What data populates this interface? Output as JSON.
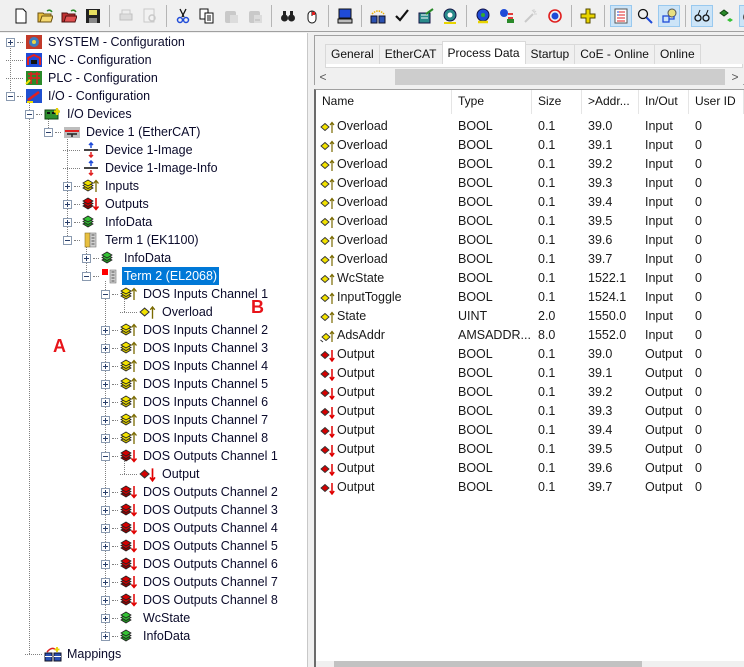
{
  "toolbar": {
    "buttons": [
      {
        "name": "new-icon"
      },
      {
        "name": "open-icon"
      },
      {
        "name": "open-project-icon"
      },
      {
        "name": "save-icon"
      },
      {
        "sep": true
      },
      {
        "name": "print-icon",
        "disabled": true
      },
      {
        "name": "print-preview-icon",
        "disabled": true
      },
      {
        "sep": true
      },
      {
        "name": "cut-icon"
      },
      {
        "name": "copy-icon"
      },
      {
        "name": "paste-icon",
        "disabled": true
      },
      {
        "name": "paste-with-links-icon",
        "disabled": true
      },
      {
        "sep": true
      },
      {
        "name": "find-icon"
      },
      {
        "name": "mouse-icon"
      },
      {
        "sep": true
      },
      {
        "name": "choose-target-icon"
      },
      {
        "sep": true
      },
      {
        "name": "generate-mappings-icon"
      },
      {
        "name": "check-configuration-icon"
      },
      {
        "name": "activate-configuration-icon"
      },
      {
        "name": "restart-config-mode-icon"
      },
      {
        "sep": true
      },
      {
        "name": "load-io-devices-icon"
      },
      {
        "name": "scan-devices-icon"
      },
      {
        "name": "wizard-icon",
        "disabled": true
      },
      {
        "name": "reload-icon"
      },
      {
        "sep": true
      },
      {
        "name": "add-item-icon"
      },
      {
        "sep": true
      },
      {
        "name": "show-list-icon",
        "active": true
      },
      {
        "name": "zoom-icon"
      },
      {
        "name": "online-values-icon",
        "active": true
      },
      {
        "sep": true
      },
      {
        "name": "watch-icon",
        "active": true
      },
      {
        "name": "toggle-icon"
      },
      {
        "name": "help-iq-icon",
        "active": true
      },
      {
        "sep": true
      },
      {
        "name": "help-book-icon"
      }
    ]
  },
  "tree": {
    "items": [
      {
        "label": "SYSTEM - Configuration",
        "level": 0,
        "expander": "plus",
        "icon": "system-config-icon"
      },
      {
        "label": "NC - Configuration",
        "level": 0,
        "expander": "none",
        "icon": "nc-config-icon"
      },
      {
        "label": "PLC - Configuration",
        "level": 0,
        "expander": "none",
        "icon": "plc-config-icon"
      },
      {
        "label": "I/O - Configuration",
        "level": 0,
        "expander": "minus",
        "icon": "io-config-icon"
      },
      {
        "label": "I/O Devices",
        "level": 1,
        "expander": "minus",
        "icon": "io-devices-icon"
      },
      {
        "label": "Device 1 (EtherCAT)",
        "level": 2,
        "expander": "minus",
        "icon": "ethercat-device-icon"
      },
      {
        "label": "Device 1-Image",
        "level": 3,
        "expander": "none",
        "icon": "process-image-icon"
      },
      {
        "label": "Device 1-Image-Info",
        "level": 3,
        "expander": "none",
        "icon": "process-image-icon"
      },
      {
        "label": "Inputs",
        "level": 3,
        "expander": "plus",
        "icon": "input-var-group-icon"
      },
      {
        "label": "Outputs",
        "level": 3,
        "expander": "plus",
        "icon": "output-var-group-icon"
      },
      {
        "label": "InfoData",
        "level": 3,
        "expander": "plus",
        "icon": "infodata-icon"
      },
      {
        "label": "Term 1 (EK1100)",
        "level": 3,
        "expander": "minus",
        "icon": "coupler-terminal-icon"
      },
      {
        "label": "InfoData",
        "level": 4,
        "expander": "plus",
        "icon": "infodata-icon"
      },
      {
        "label": "Term 2 (EL2068)",
        "level": 4,
        "expander": "minus",
        "icon": "terminal-error-icon",
        "selected": true
      },
      {
        "label": "DOS Inputs Channel 1",
        "level": 5,
        "expander": "minus",
        "icon": "input-var-group-icon"
      },
      {
        "label": "Overload",
        "level": 6,
        "expander": "none",
        "icon": "input-var-icon"
      },
      {
        "label": "DOS Inputs Channel 2",
        "level": 5,
        "expander": "plus",
        "icon": "input-var-group-icon"
      },
      {
        "label": "DOS Inputs Channel 3",
        "level": 5,
        "expander": "plus",
        "icon": "input-var-group-icon"
      },
      {
        "label": "DOS Inputs Channel 4",
        "level": 5,
        "expander": "plus",
        "icon": "input-var-group-icon"
      },
      {
        "label": "DOS Inputs Channel 5",
        "level": 5,
        "expander": "plus",
        "icon": "input-var-group-icon"
      },
      {
        "label": "DOS Inputs Channel 6",
        "level": 5,
        "expander": "plus",
        "icon": "input-var-group-icon"
      },
      {
        "label": "DOS Inputs Channel 7",
        "level": 5,
        "expander": "plus",
        "icon": "input-var-group-icon"
      },
      {
        "label": "DOS Inputs Channel 8",
        "level": 5,
        "expander": "plus",
        "icon": "input-var-group-icon"
      },
      {
        "label": "DOS Outputs Channel 1",
        "level": 5,
        "expander": "minus",
        "icon": "output-var-group-icon"
      },
      {
        "label": "Output",
        "level": 6,
        "expander": "none",
        "icon": "output-var-icon"
      },
      {
        "label": "DOS Outputs Channel 2",
        "level": 5,
        "expander": "plus",
        "icon": "output-var-group-icon"
      },
      {
        "label": "DOS Outputs Channel 3",
        "level": 5,
        "expander": "plus",
        "icon": "output-var-group-icon"
      },
      {
        "label": "DOS Outputs Channel 4",
        "level": 5,
        "expander": "plus",
        "icon": "output-var-group-icon"
      },
      {
        "label": "DOS Outputs Channel 5",
        "level": 5,
        "expander": "plus",
        "icon": "output-var-group-icon"
      },
      {
        "label": "DOS Outputs Channel 6",
        "level": 5,
        "expander": "plus",
        "icon": "output-var-group-icon"
      },
      {
        "label": "DOS Outputs Channel 7",
        "level": 5,
        "expander": "plus",
        "icon": "output-var-group-icon"
      },
      {
        "label": "DOS Outputs Channel 8",
        "level": 5,
        "expander": "plus",
        "icon": "output-var-group-icon"
      },
      {
        "label": "WcState",
        "level": 5,
        "expander": "plus",
        "icon": "infodata-icon"
      },
      {
        "label": "InfoData",
        "level": 5,
        "expander": "plus",
        "icon": "infodata-icon"
      },
      {
        "label": "Mappings",
        "level": 1,
        "expander": "none",
        "icon": "mappings-icon"
      }
    ]
  },
  "annotations": {
    "a": "A",
    "b": "B"
  },
  "tabs": [
    {
      "label": "General"
    },
    {
      "label": "EtherCAT"
    },
    {
      "label": "Process Data",
      "active": true
    },
    {
      "label": "Startup"
    },
    {
      "label": "CoE - Online"
    },
    {
      "label": "Online"
    }
  ],
  "scroll": {
    "left_arrow": "<",
    "right_arrow": ">"
  },
  "table": {
    "columns": [
      "Name",
      "Type",
      "Size",
      ">Addr...",
      "In/Out",
      "User ID"
    ],
    "rows": [
      {
        "name": "Overload",
        "type": "BOOL",
        "size": "0.1",
        "addr": "39.0",
        "inout": "Input",
        "userid": "0",
        "icon": "input-var-icon"
      },
      {
        "name": "Overload",
        "type": "BOOL",
        "size": "0.1",
        "addr": "39.1",
        "inout": "Input",
        "userid": "0",
        "icon": "input-var-icon"
      },
      {
        "name": "Overload",
        "type": "BOOL",
        "size": "0.1",
        "addr": "39.2",
        "inout": "Input",
        "userid": "0",
        "icon": "input-var-icon"
      },
      {
        "name": "Overload",
        "type": "BOOL",
        "size": "0.1",
        "addr": "39.3",
        "inout": "Input",
        "userid": "0",
        "icon": "input-var-icon"
      },
      {
        "name": "Overload",
        "type": "BOOL",
        "size": "0.1",
        "addr": "39.4",
        "inout": "Input",
        "userid": "0",
        "icon": "input-var-icon"
      },
      {
        "name": "Overload",
        "type": "BOOL",
        "size": "0.1",
        "addr": "39.5",
        "inout": "Input",
        "userid": "0",
        "icon": "input-var-icon"
      },
      {
        "name": "Overload",
        "type": "BOOL",
        "size": "0.1",
        "addr": "39.6",
        "inout": "Input",
        "userid": "0",
        "icon": "input-var-icon"
      },
      {
        "name": "Overload",
        "type": "BOOL",
        "size": "0.1",
        "addr": "39.7",
        "inout": "Input",
        "userid": "0",
        "icon": "input-var-icon"
      },
      {
        "name": "WcState",
        "type": "BOOL",
        "size": "0.1",
        "addr": "1522.1",
        "inout": "Input",
        "userid": "0",
        "icon": "input-var-icon"
      },
      {
        "name": "InputToggle",
        "type": "BOOL",
        "size": "0.1",
        "addr": "1524.1",
        "inout": "Input",
        "userid": "0",
        "icon": "input-var-icon"
      },
      {
        "name": "State",
        "type": "UINT",
        "size": "2.0",
        "addr": "1550.0",
        "inout": "Input",
        "userid": "0",
        "icon": "input-var-icon"
      },
      {
        "name": "AdsAddr",
        "type": "AMSADDR...",
        "size": "8.0",
        "addr": "1552.0",
        "inout": "Input",
        "userid": "0",
        "icon": "input-struct-var-icon"
      },
      {
        "name": "Output",
        "type": "BOOL",
        "size": "0.1",
        "addr": "39.0",
        "inout": "Output",
        "userid": "0",
        "icon": "output-var-icon"
      },
      {
        "name": "Output",
        "type": "BOOL",
        "size": "0.1",
        "addr": "39.1",
        "inout": "Output",
        "userid": "0",
        "icon": "output-var-icon"
      },
      {
        "name": "Output",
        "type": "BOOL",
        "size": "0.1",
        "addr": "39.2",
        "inout": "Output",
        "userid": "0",
        "icon": "output-var-icon"
      },
      {
        "name": "Output",
        "type": "BOOL",
        "size": "0.1",
        "addr": "39.3",
        "inout": "Output",
        "userid": "0",
        "icon": "output-var-icon"
      },
      {
        "name": "Output",
        "type": "BOOL",
        "size": "0.1",
        "addr": "39.4",
        "inout": "Output",
        "userid": "0",
        "icon": "output-var-icon"
      },
      {
        "name": "Output",
        "type": "BOOL",
        "size": "0.1",
        "addr": "39.5",
        "inout": "Output",
        "userid": "0",
        "icon": "output-var-icon"
      },
      {
        "name": "Output",
        "type": "BOOL",
        "size": "0.1",
        "addr": "39.6",
        "inout": "Output",
        "userid": "0",
        "icon": "output-var-icon"
      },
      {
        "name": "Output",
        "type": "BOOL",
        "size": "0.1",
        "addr": "39.7",
        "inout": "Output",
        "userid": "0",
        "icon": "output-var-icon"
      }
    ]
  },
  "colors": {
    "selection": "#0078d7",
    "annotation": "#e8141a",
    "input_icon": "#f2e200",
    "output_icon": "#d40000",
    "infodata_icon": "#2fb52f"
  }
}
